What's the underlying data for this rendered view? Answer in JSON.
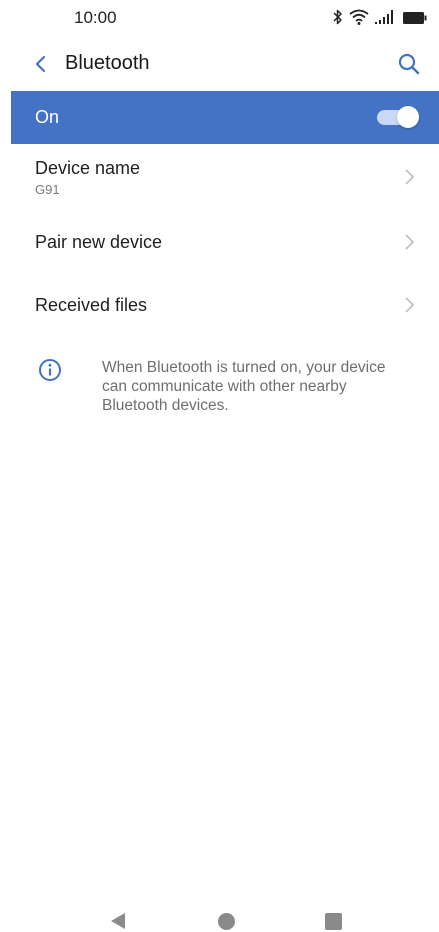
{
  "status_bar": {
    "time": "10:00",
    "icons": [
      "bluetooth-icon",
      "wifi-icon",
      "signal-icon",
      "battery-icon"
    ]
  },
  "header": {
    "title": "Bluetooth",
    "back_icon": "chevron-left-icon",
    "search_icon": "search-icon"
  },
  "toggle": {
    "label": "On",
    "state": true
  },
  "settings": {
    "device_name": {
      "title": "Device name",
      "value": "G91"
    },
    "pair": {
      "title": "Pair new device"
    },
    "received": {
      "title": "Received files"
    }
  },
  "info": {
    "icon": "info-icon",
    "text": "When Bluetooth is turned on, your device can communicate with other nearby Bluetooth devices."
  },
  "nav": {
    "icons": [
      "back-triangle-icon",
      "home-circle-icon",
      "recents-square-icon"
    ]
  },
  "colors": {
    "accent": "#4472c4",
    "toggle_track": "#c9d8f3",
    "text_primary": "#1f1f1f",
    "text_secondary": "#6f6f6f"
  }
}
